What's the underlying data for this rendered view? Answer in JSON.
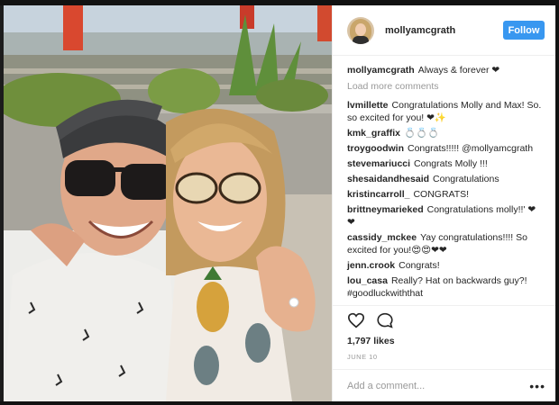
{
  "post": {
    "username": "mollyamcgrath",
    "follow_label": "Follow",
    "caption_user": "mollyamcgrath",
    "caption_text": "Always & forever ❤",
    "load_more": "Load more comments",
    "likes": "1,797 likes",
    "date": "JUNE 10",
    "add_comment_placeholder": "Add a comment...",
    "more_options": "•••"
  },
  "comments": [
    {
      "user": "lvmillette",
      "text": "Congratulations Molly and Max! So. so excited for you! ❤✨"
    },
    {
      "user": "kmk_graffix",
      "text": "💍💍💍"
    },
    {
      "user": "troygoodwin",
      "text": "Congrats!!!!! @mollyamcgrath"
    },
    {
      "user": "stevemariucci",
      "text": "Congrats Molly !!!"
    },
    {
      "user": "shesaidandhesaid",
      "text": "Congratulations"
    },
    {
      "user": "kristincarroll_",
      "text": "CONGRATS!"
    },
    {
      "user": "brittneymarieked",
      "text": "Congratulations molly!!' ❤❤"
    },
    {
      "user": "cassidy_mckee",
      "text": "Yay congratulations!!!! So excited for you!😍😍❤❤"
    },
    {
      "user": "jenn.crook",
      "text": "Congrats!"
    },
    {
      "user": "lou_casa",
      "text": "Really? Hat on backwards guy?! #goodluckwiththat"
    }
  ],
  "colors": {
    "follow_button": "#3897f0",
    "secondary_text": "#999999",
    "primary_text": "#262626"
  },
  "icons": [
    "heart-icon",
    "comment-icon",
    "more-options-icon"
  ]
}
